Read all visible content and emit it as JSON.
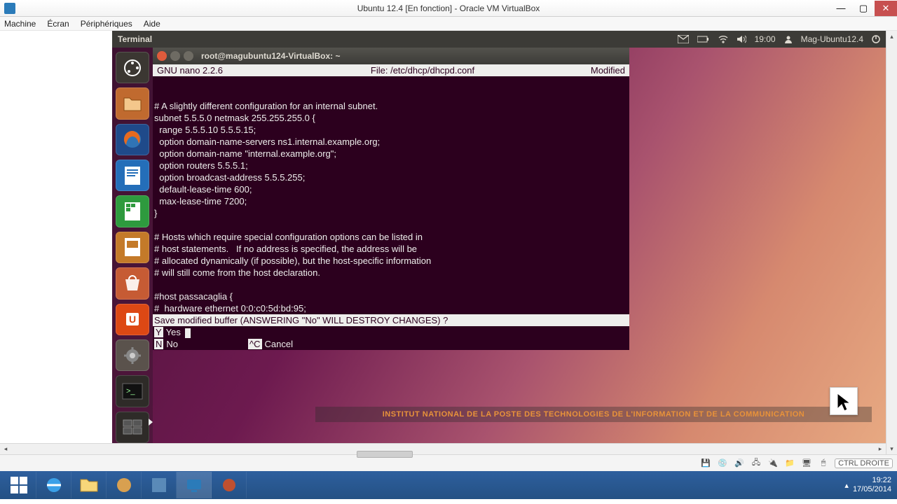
{
  "host": {
    "title": "Ubuntu 12.4 [En fonction] - Oracle VM VirtualBox",
    "menu": [
      "Machine",
      "Écran",
      "Périphériques",
      "Aide"
    ]
  },
  "unity_panel": {
    "title": "Terminal",
    "time": "19:00",
    "user": "Mag-Ubuntu12.4"
  },
  "launcher_items": [
    {
      "name": "dash",
      "label": "Dash"
    },
    {
      "name": "files",
      "label": "Files"
    },
    {
      "name": "firefox",
      "label": "Firefox"
    },
    {
      "name": "writer",
      "label": "LibreOffice Writer"
    },
    {
      "name": "calc",
      "label": "LibreOffice Calc"
    },
    {
      "name": "impress",
      "label": "LibreOffice Impress"
    },
    {
      "name": "software",
      "label": "Ubuntu Software"
    },
    {
      "name": "ubuntu-one",
      "label": "Ubuntu One"
    },
    {
      "name": "settings",
      "label": "System Settings"
    },
    {
      "name": "terminal",
      "label": "Terminal"
    },
    {
      "name": "display",
      "label": "Workspace"
    }
  ],
  "terminal": {
    "title": "root@magubuntu124-VirtualBox: ~",
    "nano": {
      "version": "GNU nano 2.2.6",
      "file": "File: /etc/dhcp/dhcpd.conf",
      "status": "Modified"
    },
    "lines": [
      "",
      "",
      "# A slightly different configuration for an internal subnet.",
      "subnet 5.5.5.0 netmask 255.255.255.0 {",
      "  range 5.5.5.10 5.5.5.15;",
      "  option domain-name-servers ns1.internal.example.org;",
      "  option domain-name \"internal.example.org\";",
      "  option routers 5.5.5.1;",
      "  option broadcast-address 5.5.5.255;",
      "  default-lease-time 600;",
      "  max-lease-time 7200;",
      "}",
      "",
      "# Hosts which require special configuration options can be listed in",
      "# host statements.   If no address is specified, the address will be",
      "# allocated dynamically (if possible), but the host-specific information",
      "# will still come from the host declaration.",
      "",
      "#host passacaglia {",
      "#  hardware ethernet 0:0:c0:5d:bd:95;"
    ],
    "prompt": "Save modified buffer (ANSWERING \"No\" WILL DESTROY CHANGES) ?",
    "options": {
      "yes_key": " Y",
      "yes": "Yes",
      "no_key": " N",
      "no": "No",
      "cancel_key": "^C",
      "cancel": "Cancel"
    }
  },
  "watermark": "INSTITUT NATIONAL DE LA POSTE DES TECHNOLOGIES DE L'INFORMATION ET DE LA COMMUNICATION",
  "vbox_status": {
    "hostkey": "CTRL DROITE"
  },
  "taskbar": {
    "clock_time": "19:22",
    "clock_date": "17/05/2014"
  }
}
